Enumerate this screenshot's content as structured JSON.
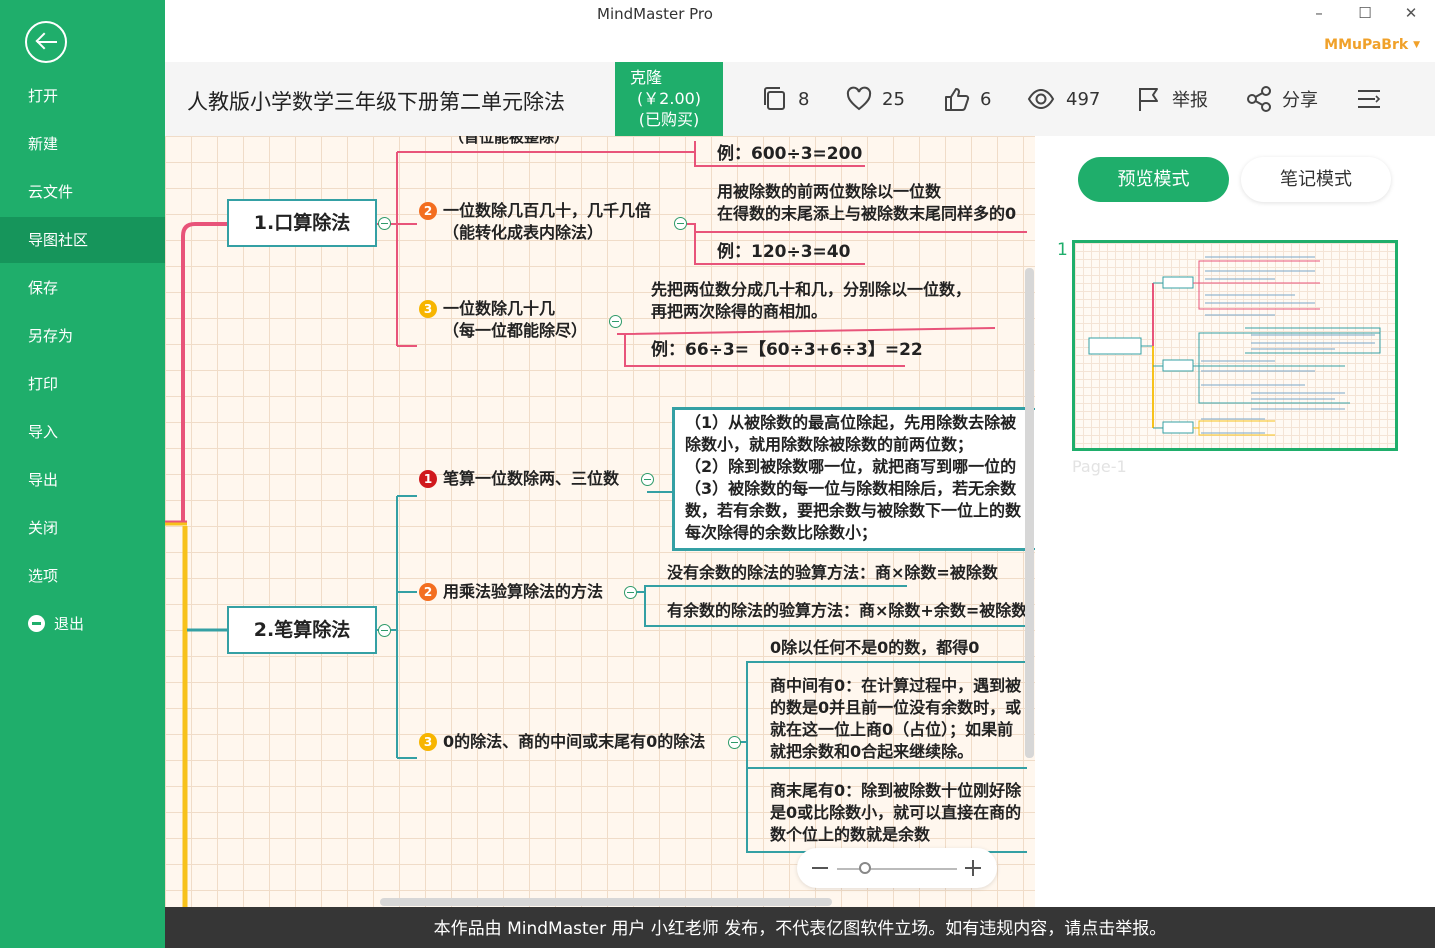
{
  "app": {
    "title": "MindMaster Pro",
    "user": "MMuPaBrk"
  },
  "window": {
    "minimize": "–",
    "maximize": "☐",
    "close": "✕"
  },
  "sidebar": {
    "items": [
      {
        "label": "打开"
      },
      {
        "label": "新建"
      },
      {
        "label": "云文件"
      },
      {
        "label": "导图社区",
        "active": true
      },
      {
        "label": "保存"
      },
      {
        "label": "另存为"
      },
      {
        "label": "打印"
      },
      {
        "label": "导入"
      },
      {
        "label": "导出"
      },
      {
        "label": "关闭"
      },
      {
        "label": "选项"
      },
      {
        "label": "退出"
      }
    ]
  },
  "header": {
    "title": "人教版小学数学三年级下册第二单元除法",
    "clone": {
      "label": "克隆",
      "price": "(￥2.00)",
      "status": "(已购买)"
    },
    "stats": {
      "pages": "8",
      "favorites": "25",
      "likes": "6",
      "views": "497",
      "report": "举报",
      "share": "分享"
    }
  },
  "colors": {
    "brand": "#1fae6b",
    "username": "#f0a12a",
    "node_border": "#34a0a4",
    "branch_pink": "#e8547a",
    "branch_yellow": "#f7c21b"
  },
  "mindmap": {
    "top_cut": "（首位能被整除）",
    "ex1": "例：600÷3=200",
    "main1": "1.口算除法",
    "b12": [
      "一位数除几百几十，几千几倍",
      "（能转化成表内除法）"
    ],
    "b12_desc": [
      "用被除数的前两位数除以一位数",
      "在得数的末尾添上与被除数末尾同样多的0"
    ],
    "ex2": "例：120÷3=40",
    "b13": [
      "一位数除几十几",
      "（每一位都能除尽）"
    ],
    "b13_desc": [
      "先把两位数分成几十和几，分别除以一位数，",
      "再把两次除得的商相加。"
    ],
    "ex3": "例：66÷3=【60÷3+6÷3】=22",
    "main2": "2.笔算除法",
    "b21": "笔算一位数除两、三位数",
    "b21_desc": [
      "（1）从被除数的最高位除起，先用除数去除被",
      "除数小，就用除数除被除数的前两位数；",
      "（2）除到被除数哪一位，就把商写到哪一位的",
      "（3）被除数的每一位与除数相除后，若无余数",
      "数，若有余数，要把余数与被除数下一位上的数",
      "每次除得的余数比除数小；"
    ],
    "b22": "用乘法验算除法的方法",
    "b22_a": "没有余数的除法的验算方法：商×除数=被除数",
    "b22_b": "有余数的除法的验算方法：商×除数+余数=被除数",
    "b23": "0的除法、商的中间或末尾有0的除法",
    "b23_a": "0除以任何不是0的数，都得0",
    "b23_b": [
      "商中间有0：在计算过程中，遇到被",
      "的数是0并且前一位没有余数时，或",
      "就在这一位上商0（占位）；如果前",
      "就把余数和0合起来继续除。"
    ],
    "b23_c": [
      "商末尾有0：除到被除数十位刚好除",
      "是0或比除数小，就可以直接在商的",
      "数个位上的数就是余数"
    ],
    "badges": [
      "1",
      "2",
      "3"
    ]
  },
  "zoom": {
    "minus": "−",
    "plus": "+"
  },
  "right_panel": {
    "preview_mode": "预览模式",
    "note_mode": "笔记模式",
    "page_number": "1",
    "page_label": "Page-1"
  },
  "footer": {
    "text": "本作品由 MindMaster 用户 小红老师 发布，不代表亿图软件立场。如有违规内容，请点击举报。"
  }
}
